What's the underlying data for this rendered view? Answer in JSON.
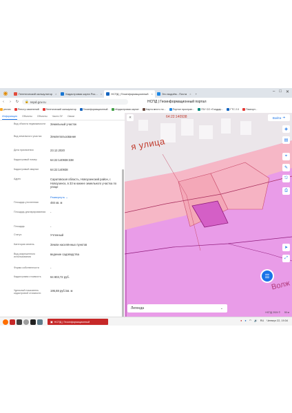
{
  "browser": {
    "tabs": [
      {
        "label": "Генетический калькулятор",
        "active": false,
        "color": "#e24c3c"
      },
      {
        "label": "Кадастровая карта Рос...",
        "active": false,
        "color": "#1976d2"
      },
      {
        "label": "НСПД | Геоинформационный",
        "active": true,
        "color": "#1565c0"
      },
      {
        "label": "Это водоём - Почта",
        "active": false,
        "color": "#1e88e5"
      }
    ],
    "url": "nspd.gov.ru",
    "page_title": "НСПД | Геоинформационный портал",
    "bookmarks": [
      {
        "label": "ресгис",
        "color": "#f9a825"
      },
      {
        "label": "Реестр изменений",
        "color": "#e53935"
      },
      {
        "label": "Генетический калькулятор",
        "color": "#e53935"
      },
      {
        "label": "Геоинформационный",
        "color": "#1565c0"
      },
      {
        "label": "«Кадастровая карта»",
        "color": "#43a047"
      },
      {
        "label": "Карта место по...",
        "color": "#6d4c41"
      },
      {
        "label": "Портал простран...",
        "color": "#1e88e5"
      },
      {
        "label": "ГБУ СО «Государ...",
        "color": "#00897b"
      },
      {
        "label": "ГТС 2.0",
        "color": "#1565c0"
      },
      {
        "label": "Паспорт...",
        "color": "#e53935"
      }
    ]
  },
  "panel": {
    "tabs": [
      "Информация",
      "Объекты",
      "Объекты",
      "Части ЗУ",
      "Связи"
    ],
    "active_tab": 0,
    "fields": [
      {
        "key": "Вид объекта недвижимости",
        "value": "Земельный участок"
      },
      {
        "key": "Вид земельного участка",
        "value": "Землепользование"
      },
      {
        "key": "Дата присвоения",
        "value": "23.12.2020"
      },
      {
        "key": "Кадастровый номер",
        "value": "64:22:140938:338"
      },
      {
        "key": "Кадастровый квартал",
        "value": "64:22:140938"
      },
      {
        "key": "Адрес",
        "value": "Саратовская область, Новоузенский район, г. Новоузенск, в 33 м южнее земельного участка по улице"
      },
      {
        "key": "Площадь уточненная",
        "value": "484 кв. м"
      },
      {
        "key": "Площадь декларированная",
        "value": "-"
      },
      {
        "key": "Площадь",
        "value": "-"
      },
      {
        "key": "Статус",
        "value": "Учтенный"
      },
      {
        "key": "Категория земель",
        "value": "Земли населённых пунктов"
      },
      {
        "key": "Вид разрешенного использования",
        "value": "ведение садоводства"
      },
      {
        "key": "Форма собственности",
        "value": "-"
      },
      {
        "key": "Кадастровая стоимость",
        "value": "94 803,72 руб."
      },
      {
        "key": "Удельный показатель кадастровой стоимости",
        "value": "195,88 руб./кв. м"
      }
    ],
    "more_link": "Развернуть"
  },
  "map": {
    "cad_label": "64:22:140938",
    "street_label": "я  улица",
    "street_label2": "Волж",
    "login_label": "Войти",
    "legend_label": "Легенда",
    "footer": [
      "НСПД 2024 ©",
      "50 м"
    ]
  },
  "taskbar": {
    "app_label": "НСПД | Геоинформационный",
    "lang": "RU",
    "clock": "Четверг 22, 19:34"
  }
}
